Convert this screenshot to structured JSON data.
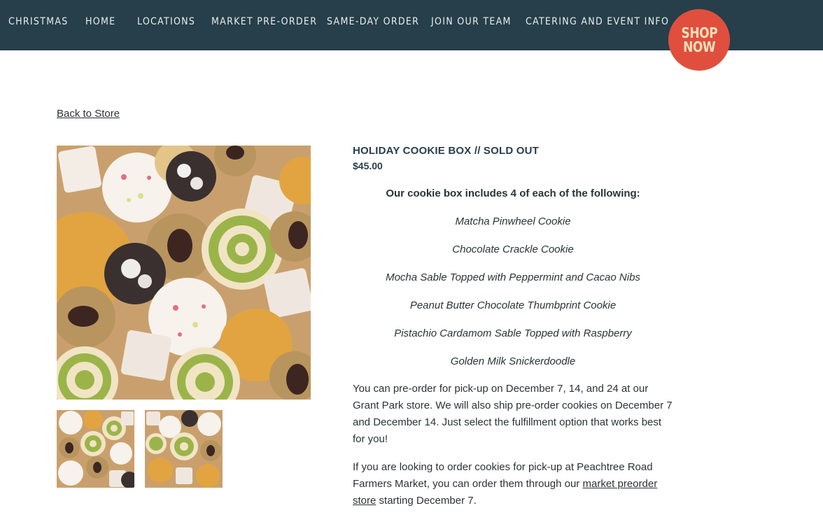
{
  "nav": {
    "items": [
      {
        "label": "CHRISTMAS"
      },
      {
        "label": "HOME"
      },
      {
        "label": "LOCATIONS"
      },
      {
        "label": "MARKET PRE-ORDER"
      },
      {
        "label": "SAME-DAY ORDER"
      },
      {
        "label": "JOIN OUR TEAM"
      },
      {
        "label": "CATERING AND EVENT INFO"
      }
    ],
    "shop_now": {
      "line1": "SHOP",
      "line2": "NOW"
    }
  },
  "back_link": "Back to Store",
  "product": {
    "title": "HOLIDAY COOKIE BOX // SOLD OUT",
    "price": "$45.00",
    "intro": "Our cookie box includes 4 of each of the following:",
    "items": [
      "Matcha Pinwheel Cookie",
      "Chocolate Crackle Cookie",
      "Mocha Sable Topped with Peppermint and Cacao Nibs",
      "Peanut Butter Chocolate Thumbprint Cookie",
      "Pistachio Cardamom Sable Topped with Raspberry",
      "Golden Milk Snickerdoodle"
    ],
    "para1": "You can pre-order for pick-up on December 7, 14, and 24 at our Grant Park store. We will also ship pre-order cookies on December 7 and December 14. Just select the fulfillment option that works best for you!",
    "para2_before": "If you are looking to order cookies for pick-up at Peachtree Road Farmers Market, you can order them through our ",
    "para2_link": "market preorder store",
    "para2_after": " starting December 7."
  },
  "colors": {
    "nav_bg": "#263f4a",
    "shop_now_bg": "#e04f3e",
    "shop_now_text": "#f6dfb8"
  }
}
